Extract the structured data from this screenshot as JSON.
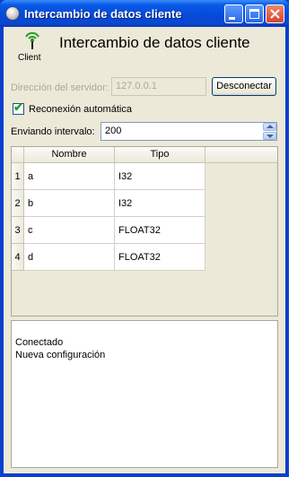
{
  "window": {
    "title": "Intercambio de datos cliente",
    "icon": "globe-icon"
  },
  "header": {
    "logo_icon": "wireless-antenna-icon",
    "logo_label": "Client",
    "title": "Intercambio de datos cliente"
  },
  "server": {
    "label": "Dirección del servidor:",
    "value": "127.0.0.1",
    "disconnect_label": "Desconectar"
  },
  "reconnect": {
    "label": "Reconexión automática",
    "checked": true
  },
  "interval": {
    "label": "Enviando intervalo:",
    "value": "200"
  },
  "table": {
    "columns": [
      "Nombre",
      "Tipo"
    ],
    "rows": [
      {
        "index": "1",
        "name": "a",
        "type": "I32"
      },
      {
        "index": "2",
        "name": "b",
        "type": "I32"
      },
      {
        "index": "3",
        "name": "c",
        "type": "FLOAT32"
      },
      {
        "index": "4",
        "name": "d",
        "type": "FLOAT32"
      }
    ]
  },
  "log": {
    "lines": [
      "Conectado",
      "Nueva configuración"
    ]
  },
  "colors": {
    "titlebar": "#0a5ae8",
    "client_bg": "#ece9d8",
    "checkmark": "#21a121"
  }
}
